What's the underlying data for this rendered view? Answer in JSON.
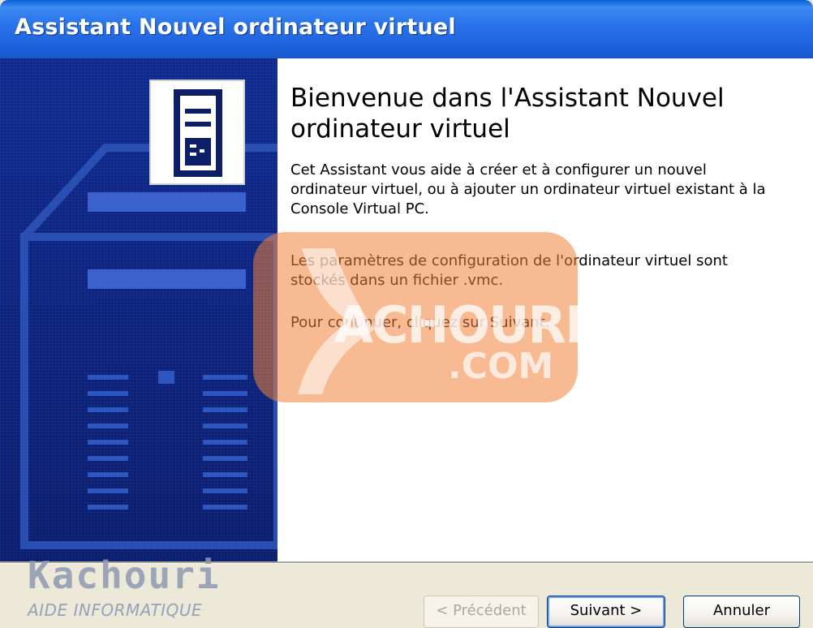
{
  "window": {
    "title": "Assistant Nouvel ordinateur virtuel"
  },
  "content": {
    "heading": "Bienvenue dans l'Assistant Nouvel ordinateur virtuel",
    "paragraphs": [
      "Cet Assistant vous aide à créer et à configurer un nouvel ordinateur virtuel, ou à ajouter un ordinateur virtuel existant à la Console Virtual PC.",
      "Les paramètres de configuration de l'ordinateur virtuel sont stockés dans un fichier .vmc.",
      "Pour continuer, cliquez sur Suivant."
    ]
  },
  "buttons": {
    "previous": "< Précédent",
    "next": "Suivant >",
    "cancel": "Annuler"
  },
  "watermark": {
    "line1": "ACHOURI",
    "line2": ".COM",
    "logo": "Kachouri",
    "tagline": "AIDE INFORMATIQUE"
  },
  "icons": {
    "banner_icon": "computer-tower-icon"
  },
  "colors": {
    "titlebar": "#2a74ea",
    "banner": "#0c1f7a",
    "watermark": "#f18238",
    "content_bg": "#ffffff"
  }
}
